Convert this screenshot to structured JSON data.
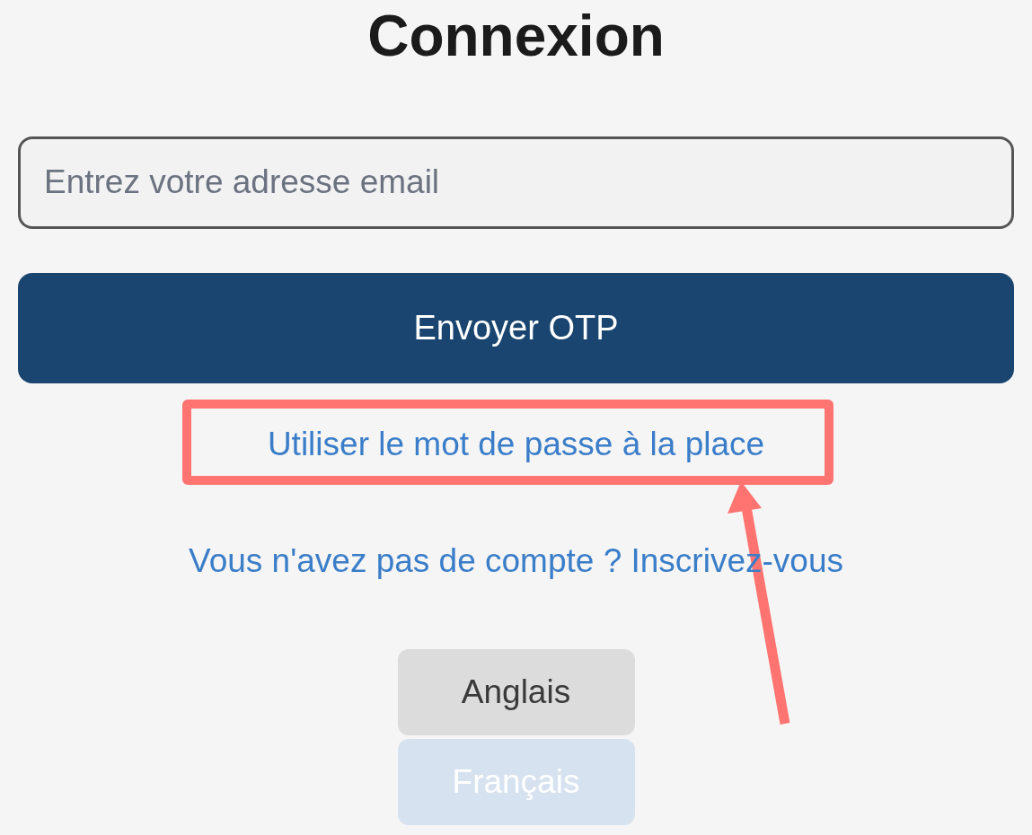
{
  "title": "Connexion",
  "email_field": {
    "placeholder": "Entrez votre adresse email"
  },
  "send_button": "Envoyer OTP",
  "password_link": "Utiliser le mot de passe à la place",
  "signup_link": "Vous n'avez pas de compte ? Inscrivez-vous",
  "languages": [
    {
      "label": "Anglais",
      "selected": false
    },
    {
      "label": "Français",
      "selected": true
    }
  ]
}
